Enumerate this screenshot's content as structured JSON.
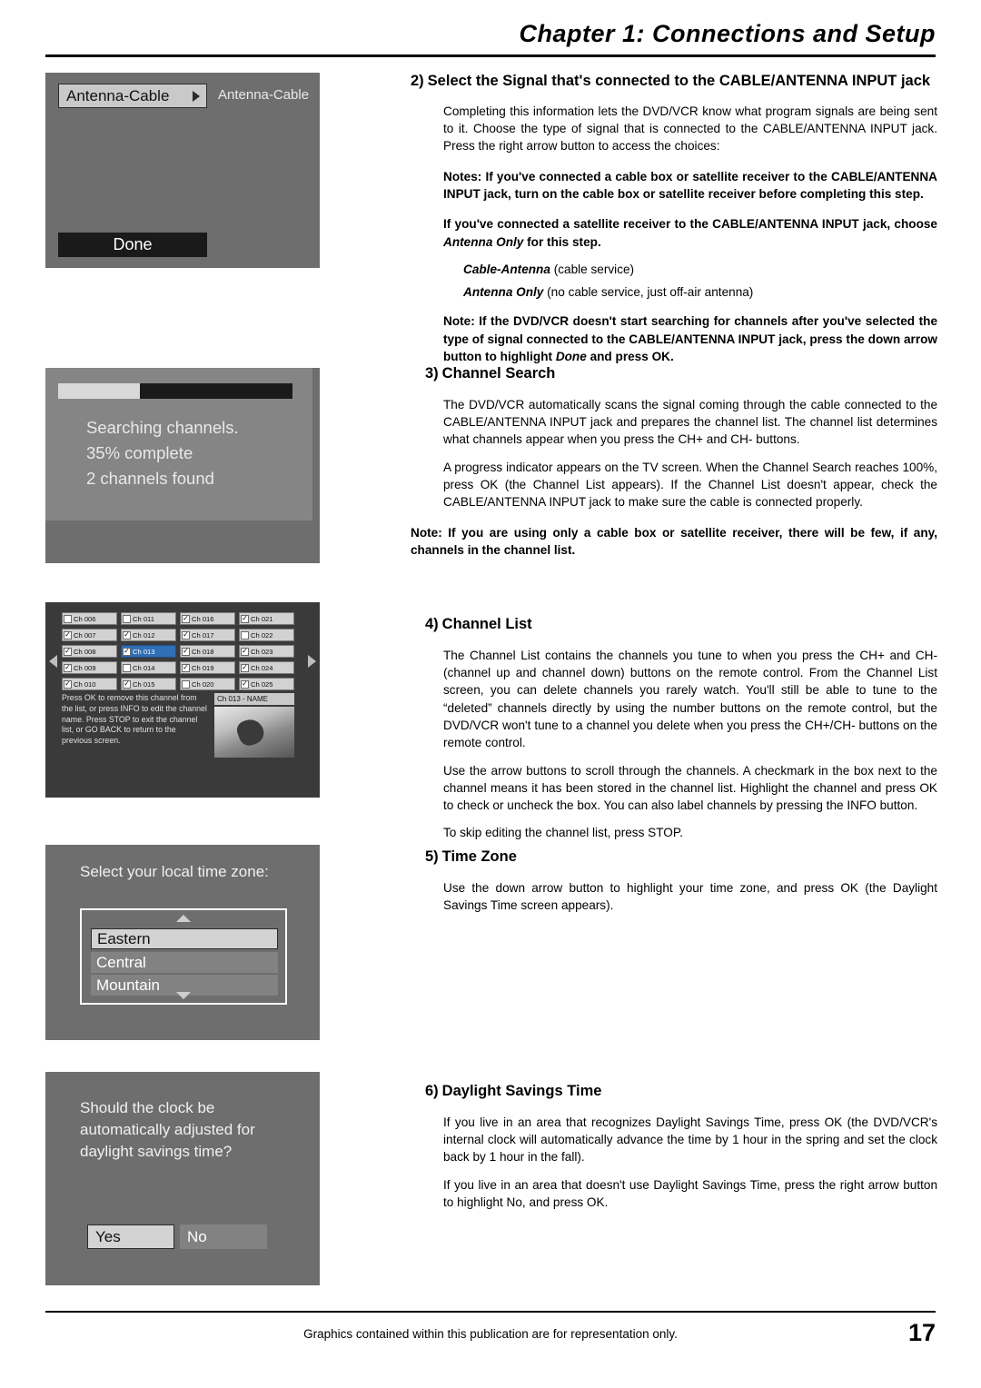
{
  "header": {
    "chapter_title": "Chapter 1: Connections and Setup"
  },
  "footer": {
    "note": "Graphics contained within this publication are for representation only.",
    "page_number": "17"
  },
  "sections": [
    {
      "num": "2)",
      "title": "Select the Signal that's connected to the CABLE/ANTENNA INPUT jack",
      "paragraphs": [
        "Completing this information lets the DVD/VCR know what program signals are being sent to it. Choose the type of signal that is connected to the CABLE/ANTENNA INPUT jack. Press the right arrow button to access the choices:"
      ],
      "note1": "Notes: If you've connected a cable box or satellite receiver to the CABLE/ANTENNA INPUT jack, turn on the cable box or satellite receiver before completing this step.",
      "note2_a": "If you've connected a satellite receiver to the CABLE/ANTENNA INPUT jack, choose ",
      "note2_b": "Antenna Only",
      "note2_c": " for this step.",
      "choice1_b": "Cable-Antenna",
      "choice1_r": " (cable service)",
      "choice2_b": "Antenna Only",
      "choice2_r": " (no cable service, just off-air antenna)",
      "note3_a": "Note: If the DVD/VCR doesn't start searching for channels after you've selected the type of signal connected to the CABLE/ANTENNA INPUT jack, press the down arrow button to highlight ",
      "note3_b": "Done",
      "note3_c": " and press OK."
    },
    {
      "num": "3)",
      "title": "Channel Search",
      "paragraphs": [
        "The DVD/VCR automatically scans the signal coming through the cable connected to the CABLE/ANTENNA INPUT jack and prepares the channel list. The channel list determines what channels appear when you press the CH+ and CH- buttons.",
        "A progress indicator appears on the TV screen. When the Channel Search reaches 100%, press OK (the Channel List appears). If the Channel List doesn't appear, check the CABLE/ANTENNA INPUT jack to make sure the cable is connected properly."
      ],
      "note": "Note: If you are using only a cable box or satellite receiver, there will be few, if any, channels in the channel list."
    },
    {
      "num": "4)",
      "title": "Channel List",
      "paragraphs": [
        "The Channel List contains the channels you tune to when you press the CH+ and CH- (channel up and channel down) buttons on the remote control. From the Channel List screen, you can delete channels you rarely watch. You'll still be able to tune to the “deleted” channels directly by using the number buttons on the remote control, but the DVD/VCR won't tune to a channel you delete when you press the CH+/CH- buttons on the remote control.",
        "Use the  arrow buttons to scroll through the channels. A checkmark in the box next to the channel means it has been stored in the channel list. Highlight the channel and press OK to check or uncheck the box. You can also label channels by pressing the INFO button.",
        "To skip editing the channel list, press STOP."
      ]
    },
    {
      "num": "5)",
      "title": "Time Zone",
      "paragraphs": [
        "Use the down arrow button to highlight your time zone, and press OK (the Daylight Savings Time screen appears)."
      ]
    },
    {
      "num": "6)",
      "title": "Daylight Savings Time",
      "paragraphs": [
        "If you live in an area that recognizes Daylight Savings Time, press OK (the DVD/VCR's internal clock will automatically advance the time by 1 hour in the spring and set the clock back by 1 hour in the fall).",
        "If you live in an area that doesn't use Daylight Savings Time, press the right arrow button to highlight No, and press OK."
      ],
      "ital_word": "No"
    }
  ],
  "figures": {
    "antenna": {
      "selected_value": "Antenna-Cable",
      "side_label": "Antenna-Cable",
      "done_label": "Done"
    },
    "search": {
      "progress_percent": 35,
      "line1": "Searching channels.",
      "line2": "35% complete",
      "line3": "2 channels found"
    },
    "channel_list": {
      "rows": [
        [
          {
            "label": "Ch 006",
            "checked": false,
            "selected": false
          },
          {
            "label": "Ch 011",
            "checked": false,
            "selected": false
          },
          {
            "label": "Ch 016",
            "checked": true,
            "selected": false
          },
          {
            "label": "Ch 021",
            "checked": true,
            "selected": false
          }
        ],
        [
          {
            "label": "Ch 007",
            "checked": true,
            "selected": false
          },
          {
            "label": "Ch 012",
            "checked": true,
            "selected": false
          },
          {
            "label": "Ch 017",
            "checked": true,
            "selected": false
          },
          {
            "label": "Ch 022",
            "checked": false,
            "selected": false
          }
        ],
        [
          {
            "label": "Ch 008",
            "checked": true,
            "selected": false
          },
          {
            "label": "Ch 013",
            "checked": true,
            "selected": true
          },
          {
            "label": "Ch 018",
            "checked": true,
            "selected": false
          },
          {
            "label": "Ch 023",
            "checked": true,
            "selected": false
          }
        ],
        [
          {
            "label": "Ch 009",
            "checked": true,
            "selected": false
          },
          {
            "label": "Ch 014",
            "checked": false,
            "selected": false
          },
          {
            "label": "Ch 019",
            "checked": true,
            "selected": false
          },
          {
            "label": "Ch 024",
            "checked": true,
            "selected": false
          }
        ],
        [
          {
            "label": "Ch 010",
            "checked": true,
            "selected": false
          },
          {
            "label": "Ch 015",
            "checked": true,
            "selected": false
          },
          {
            "label": "Ch 020",
            "checked": false,
            "selected": false
          },
          {
            "label": "Ch 025",
            "checked": true,
            "selected": false
          }
        ]
      ],
      "help_text": "Press OK to remove this channel from the list, or press INFO to edit the channel name. Press STOP to exit the channel list, or GO BACK to return to the previous screen.",
      "name_label": "Ch 013 - NAME"
    },
    "time_zone": {
      "prompt": "Select your local time zone:",
      "options": [
        "Eastern",
        "Central",
        "Mountain"
      ],
      "selected": "Eastern"
    },
    "daylight": {
      "prompt": "Should the clock be automatically adjusted for daylight savings time?",
      "yes_label": "Yes",
      "no_label": "No",
      "selected": "Yes"
    }
  }
}
